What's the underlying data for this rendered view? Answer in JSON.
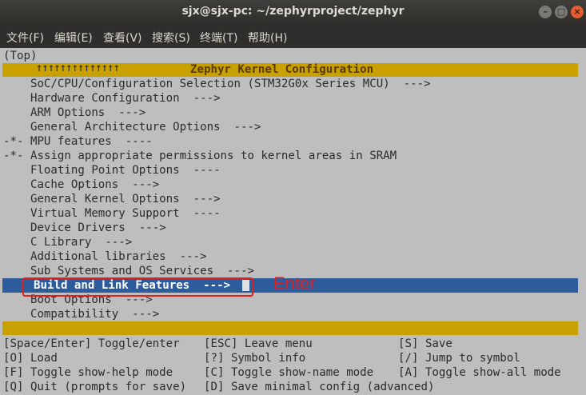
{
  "window": {
    "title": "sjx@sjx-pc: ~/zephyrproject/zephyr",
    "buttons": [
      "–",
      "□",
      "×"
    ]
  },
  "menubar": [
    "文件(F)",
    "编辑(E)",
    "查看(V)",
    "搜索(S)",
    "终端(T)",
    "帮助(H)"
  ],
  "terminal": {
    "breadcrumb": "(Top)",
    "header_title": "Zephyr Kernel Configuration",
    "header_arrows": "↑↑↑↑↑↑↑↑↑↑↑↑↑↑",
    "menu_items": [
      {
        "prefix": "    ",
        "label": "SoC/CPU/Configuration Selection (STM32G0x Series MCU)",
        "suffix": "--->"
      },
      {
        "prefix": "    ",
        "label": "Hardware Configuration",
        "suffix": "--->"
      },
      {
        "prefix": "    ",
        "label": "ARM Options",
        "suffix": "--->"
      },
      {
        "prefix": "    ",
        "label": "General Architecture Options",
        "suffix": "--->"
      },
      {
        "prefix": "-*- ",
        "label": "MPU features",
        "suffix": "----"
      },
      {
        "prefix": "-*- ",
        "label": "Assign appropriate permissions to kernel areas in SRAM",
        "suffix": ""
      },
      {
        "prefix": "    ",
        "label": "Floating Point Options",
        "suffix": "----"
      },
      {
        "prefix": "    ",
        "label": "Cache Options",
        "suffix": "--->"
      },
      {
        "prefix": "    ",
        "label": "General Kernel Options",
        "suffix": "--->"
      },
      {
        "prefix": "    ",
        "label": "Virtual Memory Support",
        "suffix": "----"
      },
      {
        "prefix": "    ",
        "label": "Device Drivers",
        "suffix": "--->"
      },
      {
        "prefix": "    ",
        "label": "C Library",
        "suffix": "--->"
      },
      {
        "prefix": "    ",
        "label": "Additional libraries",
        "suffix": "--->"
      },
      {
        "prefix": "    ",
        "label": "Sub Systems and OS Services",
        "suffix": "--->"
      }
    ],
    "selected_item": {
      "label": "Build and Link Features",
      "suffix": "--->"
    },
    "menu_items_after": [
      {
        "prefix": "    ",
        "label": "Boot Options",
        "suffix": "--->"
      },
      {
        "prefix": "    ",
        "label": "Compatibility",
        "suffix": "--->"
      }
    ],
    "annotation": "Enter",
    "keys": [
      [
        "[Space/Enter] Toggle/enter",
        "[ESC] Leave menu",
        "[S] Save"
      ],
      [
        "[O] Load",
        "[?] Symbol info",
        "[/] Jump to symbol"
      ],
      [
        "[F] Toggle show-help mode",
        "[C] Toggle show-name mode",
        "[A] Toggle show-all mode"
      ],
      [
        "[Q] Quit (prompts for save)",
        "[D] Save minimal config (advanced)",
        ""
      ]
    ]
  },
  "colors": {
    "banner": "#c8a000",
    "selection": "#2c5c9c",
    "annotation": "#e02020",
    "terminal_bg": "#bebebe"
  }
}
